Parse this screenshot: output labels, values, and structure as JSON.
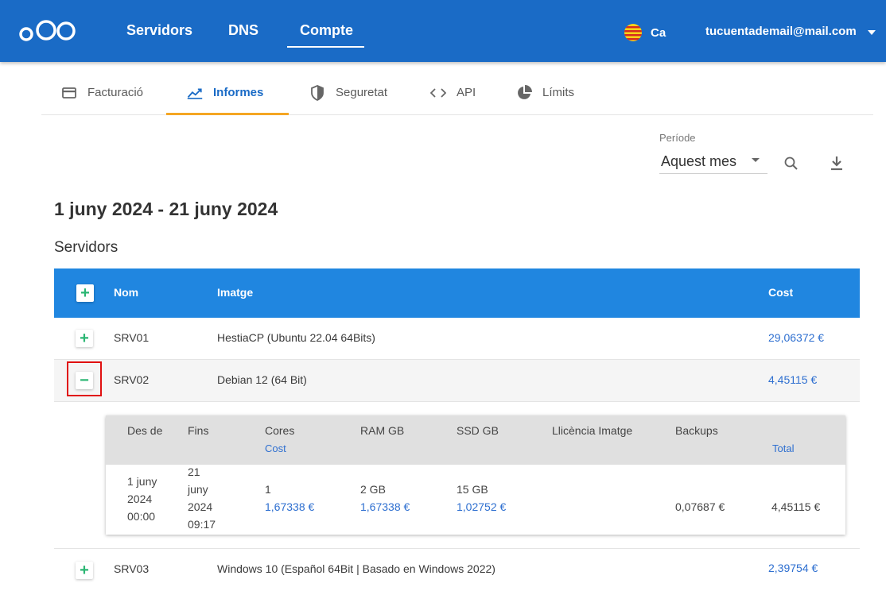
{
  "header": {
    "nav": [
      "Servidors",
      "DNS",
      "Compte"
    ],
    "active_nav": "Compte",
    "language": "Ca",
    "user_email": "tucuentademail@mail.com"
  },
  "tabs": [
    {
      "label": "Facturació",
      "icon": "credit-card-icon"
    },
    {
      "label": "Informes",
      "icon": "chart-line-icon",
      "active": true
    },
    {
      "label": "Seguretat",
      "icon": "shield-icon"
    },
    {
      "label": "API",
      "icon": "code-icon"
    },
    {
      "label": "Límits",
      "icon": "pie-chart-icon"
    }
  ],
  "period": {
    "label": "Període",
    "selected": "Aquest mes"
  },
  "range_title": "1 juny 2024 - 21 juny 2024",
  "section_title": "Servidors",
  "table": {
    "headers": {
      "name": "Nom",
      "image": "Imatge",
      "cost": "Cost"
    },
    "rows": [
      {
        "name": "SRV01",
        "image": "HestiaCP (Ubuntu 22.04 64Bits)",
        "cost": "29,06372 €"
      },
      {
        "name": "SRV02",
        "image": "Debian 12 (64 Bit)",
        "cost": "4,45115 €"
      },
      {
        "name": "SRV03",
        "image": "Windows 10 (Español 64Bit | Basado en Windows 2022)",
        "cost": "2,39754 €"
      }
    ]
  },
  "detail": {
    "headers": {
      "from": "Des de",
      "to": "Fins",
      "cores": "Cores",
      "cores_sub": "Cost",
      "ram": "RAM GB",
      "ssd": "SSD GB",
      "license": "Llicència Imatge",
      "backups": "Backups",
      "total": "Total"
    },
    "row": {
      "from": [
        "1 juny",
        "2024",
        "00:00"
      ],
      "to": [
        "21",
        "juny",
        "2024",
        "09:17"
      ],
      "cores": "1",
      "cores_cost": "1,67338 €",
      "ram": "2 GB",
      "ram_cost": "1,67338 €",
      "ssd": "15 GB",
      "ssd_cost": "1,02752 €",
      "backups_cost": "0,07687 €",
      "total": "4,45115 €"
    }
  },
  "colors": {
    "topbar": "#1a6bc6",
    "table_header": "#2086e0",
    "accent_tab": "#f5a623",
    "cost_link": "#2e6fd0",
    "plus_green": "#2bb673",
    "highlight": "#e01010"
  }
}
